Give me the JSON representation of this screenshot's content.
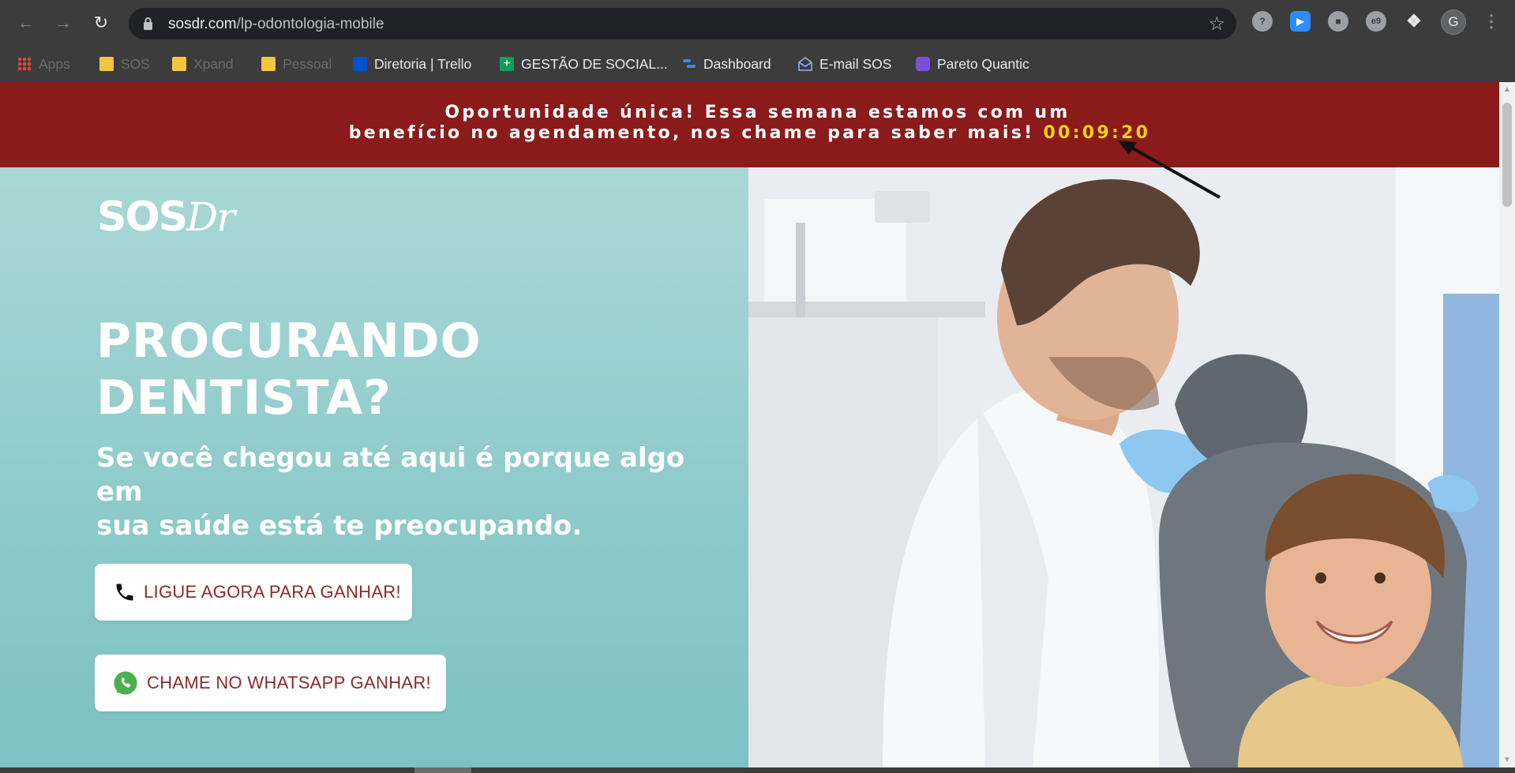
{
  "browser": {
    "url_host": "sosdr.com",
    "url_path": "/lp-odontologia-mobile",
    "avatar_initial": "G",
    "bookmarks": [
      {
        "label": "Apps",
        "icon": "apps-grid-icon"
      },
      {
        "label": "SOS",
        "icon": "folder-icon"
      },
      {
        "label": "Xpand",
        "icon": "folder-icon"
      },
      {
        "label": "Pessoal",
        "icon": "folder-icon"
      },
      {
        "label": "Diretoria | Trello",
        "icon": "trello-icon"
      },
      {
        "label": "GESTÃO DE SOCIAL...",
        "icon": "sheets-icon"
      },
      {
        "label": "Dashboard",
        "icon": "dashboard-icon"
      },
      {
        "label": "E-mail SOS",
        "icon": "mail-icon"
      },
      {
        "label": "Pareto Quantic",
        "icon": "pareto-icon"
      }
    ]
  },
  "banner": {
    "line1": "Oportunidade única! Essa semana estamos com um",
    "line2": "benefício no agendamento, nos chame para saber mais!",
    "timer": "00:09:20",
    "background": "#8b1a1a",
    "timer_color": "#f7d117"
  },
  "hero": {
    "logo": "SOS",
    "logo_suffix": "Dr",
    "headline_line1": "PROCURANDO",
    "headline_line2": "DENTISTA?",
    "subhead_line1": "Se você chegou até aqui é porque algo em",
    "subhead_line2": "sua saúde está te preocupando.",
    "cta_phone": "LIGUE AGORA PARA GANHAR!",
    "cta_whatsapp": "CHAME NO WHATSAPP GANHAR!",
    "image_subject": "dentist-with-smiling-child-photo"
  }
}
